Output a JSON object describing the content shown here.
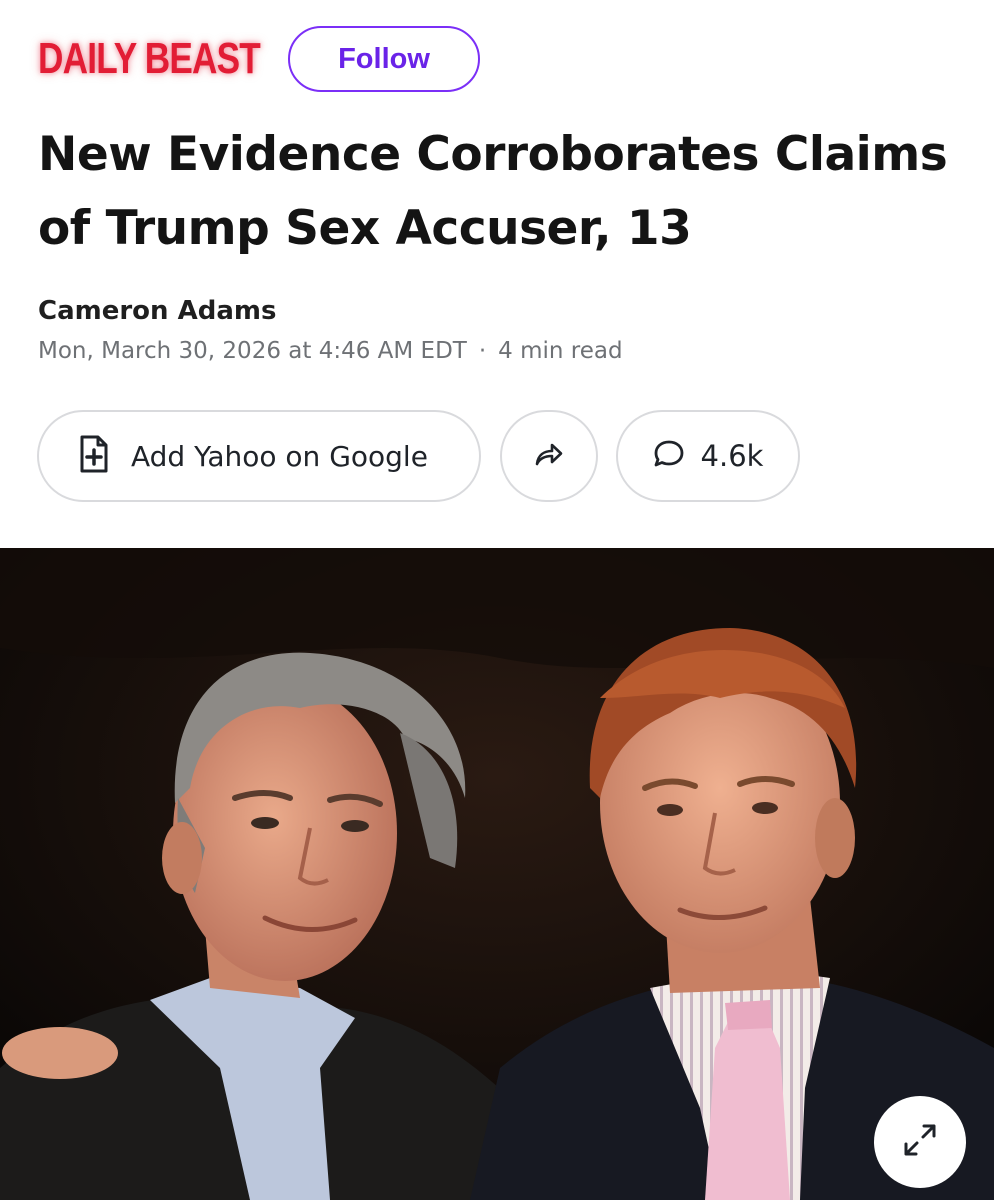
{
  "publisher": {
    "logo_text": "DAILY BEAST",
    "brand_color": "#e21d35"
  },
  "follow_button": {
    "label": "Follow",
    "accent_color": "#7b2ff7"
  },
  "article": {
    "headline": "New Evidence Corroborates Claims of Trump Sex Accuser, 13",
    "author": "Cameron Adams",
    "published": "Mon, March 30, 2026 at 4:46 AM EDT",
    "separator": "·",
    "read_time": "4 min read"
  },
  "actions": {
    "add_source": {
      "label": "Add Yahoo on Google",
      "icon": "add-document-icon"
    },
    "share": {
      "icon": "share-arrow-icon"
    },
    "comments": {
      "count": "4.6k",
      "icon": "comment-bubble-icon"
    }
  },
  "hero_image": {
    "expand_icon": "expand-arrows-icon"
  }
}
